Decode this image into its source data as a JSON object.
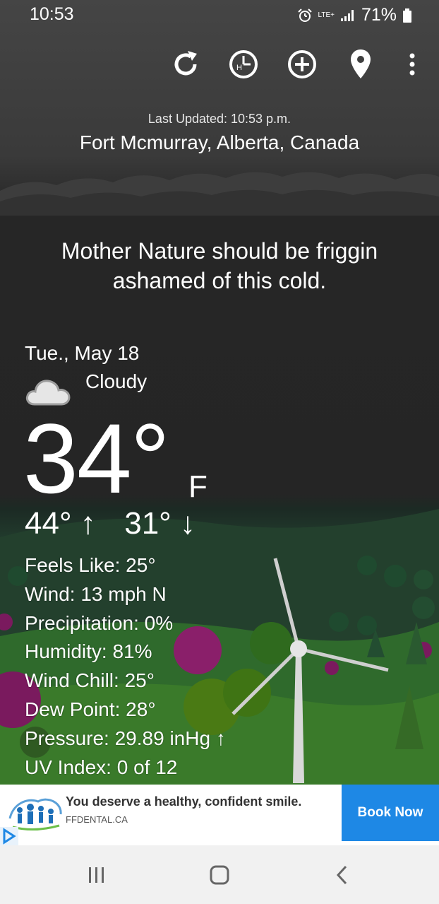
{
  "status_bar": {
    "time": "10:53",
    "network": "LTE+",
    "battery": "71%"
  },
  "toolbar": {
    "icons": [
      "refresh-icon",
      "history-clock-icon",
      "add-location-icon",
      "location-pin-icon",
      "more-vert-icon"
    ]
  },
  "header": {
    "last_updated": "Last Updated: 10:53 p.m.",
    "location": "Fort Mcmurray, Alberta, Canada"
  },
  "quip": "Mother Nature should be friggin ashamed of this cold.",
  "current": {
    "date": "Tue., May 18",
    "condition": "Cloudy",
    "condition_icon": "cloud-icon",
    "temperature": "34°",
    "unit": "F",
    "high": "44° ↑",
    "low": "31° ↓"
  },
  "details": [
    "Feels Like: 25°",
    "Wind: 13 mph N",
    "Precipitation: 0%",
    "Humidity: 81%",
    "Wind Chill: 25°",
    "Dew Point: 28°",
    "Pressure: 29.89 inHg ↑",
    "UV Index: 0 of 12"
  ],
  "ad": {
    "headline": "You deserve a healthy, confident smile.",
    "domain": "FFDENTAL.CA",
    "cta": "Book Now"
  },
  "colors": {
    "ad_cta": "#1e88e5",
    "nav_bar": "#f1f1f1"
  }
}
